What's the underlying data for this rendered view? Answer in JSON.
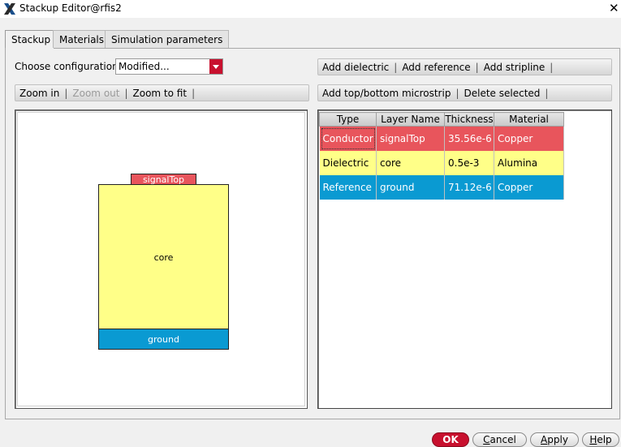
{
  "window": {
    "title": "Stackup Editor@rfis2",
    "icon": "x-logo-icon",
    "close_label": "✕"
  },
  "tabs": [
    {
      "label": "Stackup",
      "active": true
    },
    {
      "label": "Materials",
      "active": false
    },
    {
      "label": "Simulation parameters",
      "active": false
    }
  ],
  "configuration": {
    "label": "Choose configuration",
    "value": "Modified..."
  },
  "toolbar_zoom": {
    "zoom_in": "Zoom in",
    "zoom_out": "Zoom out",
    "zoom_fit": "Zoom to fit",
    "separator": "|"
  },
  "toolbar_add": {
    "add_dielectric": "Add dielectric",
    "add_reference": "Add reference",
    "add_stripline": "Add stripline"
  },
  "toolbar_add2": {
    "add_microstrip": "Add top/bottom microstrip",
    "delete_selected": "Delete selected"
  },
  "diagram": {
    "layers": [
      {
        "name": "signalTop",
        "color": "#e8555c"
      },
      {
        "name": "core",
        "color": "#ffff88"
      },
      {
        "name": "ground",
        "color": "#0a9ad2"
      }
    ]
  },
  "table": {
    "headers": [
      "Type",
      "Layer Name",
      "Thickness",
      "Material"
    ],
    "rows": [
      {
        "cells": [
          "Conductor",
          "signalTop",
          "35.56e-6",
          "Copper"
        ],
        "bg": "#e8555c",
        "fg": "#ffffff"
      },
      {
        "cells": [
          "Dielectric",
          "core",
          "0.5e-3",
          "Alumina"
        ],
        "bg": "#ffff88",
        "fg": "#000000"
      },
      {
        "cells": [
          "Reference",
          "ground",
          "71.12e-6",
          "Copper"
        ],
        "bg": "#0a9ad2",
        "fg": "#ffffff"
      }
    ]
  },
  "buttons": {
    "ok": "OK",
    "cancel": "Cancel",
    "apply": "Apply",
    "help": "Help"
  },
  "colors": {
    "accent": "#c8102e",
    "conductor": "#e8555c",
    "dielectric": "#ffff88",
    "reference": "#0a9ad2"
  }
}
